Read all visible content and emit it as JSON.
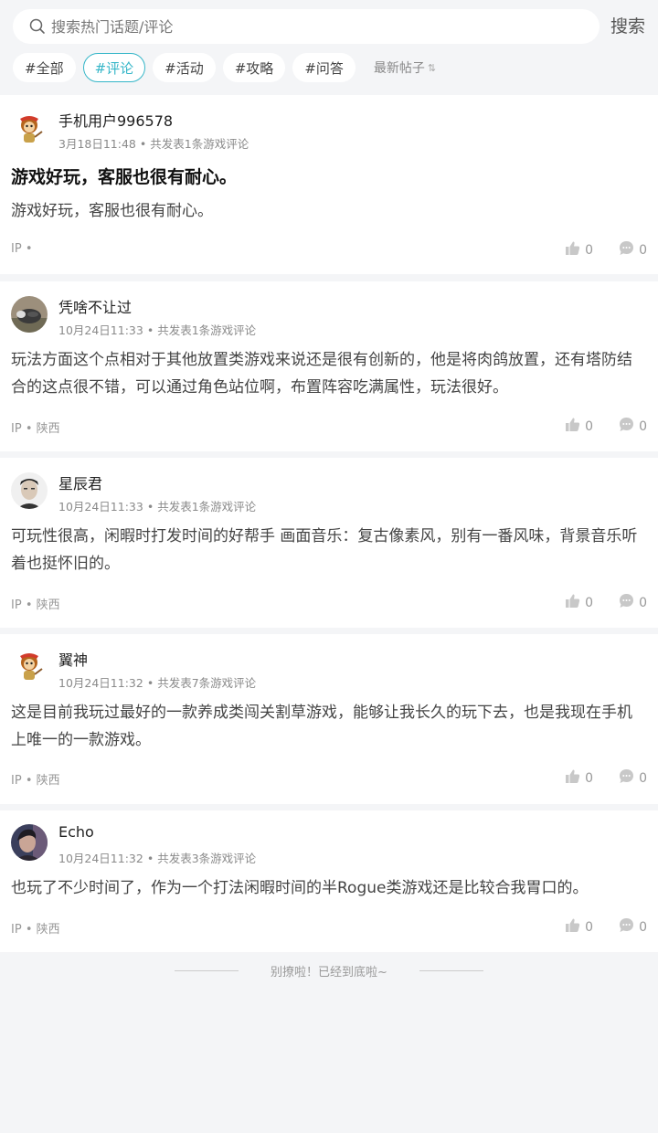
{
  "search": {
    "placeholder": "搜索热门话题/评论",
    "button_label": "搜索"
  },
  "tabs": [
    {
      "label": "#全部",
      "active": false
    },
    {
      "label": "#评论",
      "active": true
    },
    {
      "label": "#活动",
      "active": false
    },
    {
      "label": "#攻略",
      "active": false
    },
    {
      "label": "#问答",
      "active": false
    }
  ],
  "sort_label": "最新帖子",
  "colors": {
    "accent": "#35b6c8",
    "background": "#f4f5f7"
  },
  "posts": [
    {
      "username": "手机用户996578",
      "time": "3月18日11:48",
      "count_text": "共发表1条游戏评论",
      "title": "游戏好玩，客服也很有耐心。",
      "content": "游戏好玩，客服也很有耐心。",
      "ip_label": "IP",
      "ip_region": "",
      "likes": "0",
      "comments": "0",
      "avatar": "monkey-avatar"
    },
    {
      "username": "凭啥不让过",
      "time": "10月24日11:33",
      "count_text": "共发表1条游戏评论",
      "title": "",
      "content": "玩法方面这个点相对于其他放置类游戏来说还是很有创新的，他是将肉鸽放置，还有塔防结合的这点很不错，可以通过角色站位啊，布置阵容吃满属性，玩法很好。",
      "ip_label": "IP",
      "ip_region": "陕西",
      "likes": "0",
      "comments": "0",
      "avatar": "animal-photo-avatar"
    },
    {
      "username": "星辰君",
      "time": "10月24日11:33",
      "count_text": "共发表1条游戏评论",
      "title": "",
      "content": "可玩性很高，闲暇时打发时间的好帮手 画面音乐：复古像素风，别有一番风味，背景音乐听着也挺怀旧的。",
      "ip_label": "IP",
      "ip_region": "陕西",
      "likes": "0",
      "comments": "0",
      "avatar": "man-photo-avatar"
    },
    {
      "username": "翼神",
      "time": "10月24日11:32",
      "count_text": "共发表7条游戏评论",
      "title": "",
      "content": "这是目前我玩过最好的一款养成类闯关割草游戏，能够让我长久的玩下去，也是我现在手机上唯一的一款游戏。",
      "ip_label": "IP",
      "ip_region": "陕西",
      "likes": "0",
      "comments": "0",
      "avatar": "monkey-avatar"
    },
    {
      "username": "Echo",
      "time": "10月24日11:32",
      "count_text": "共发表3条游戏评论",
      "title": "",
      "content": "也玩了不少时间了，作为一个打法闲暇时间的半Rogue类游戏还是比较合我胃口的。",
      "ip_label": "IP",
      "ip_region": "陕西",
      "likes": "0",
      "comments": "0",
      "avatar": "person-photo-avatar"
    }
  ],
  "footer_text": "别撩啦！已经到底啦~"
}
